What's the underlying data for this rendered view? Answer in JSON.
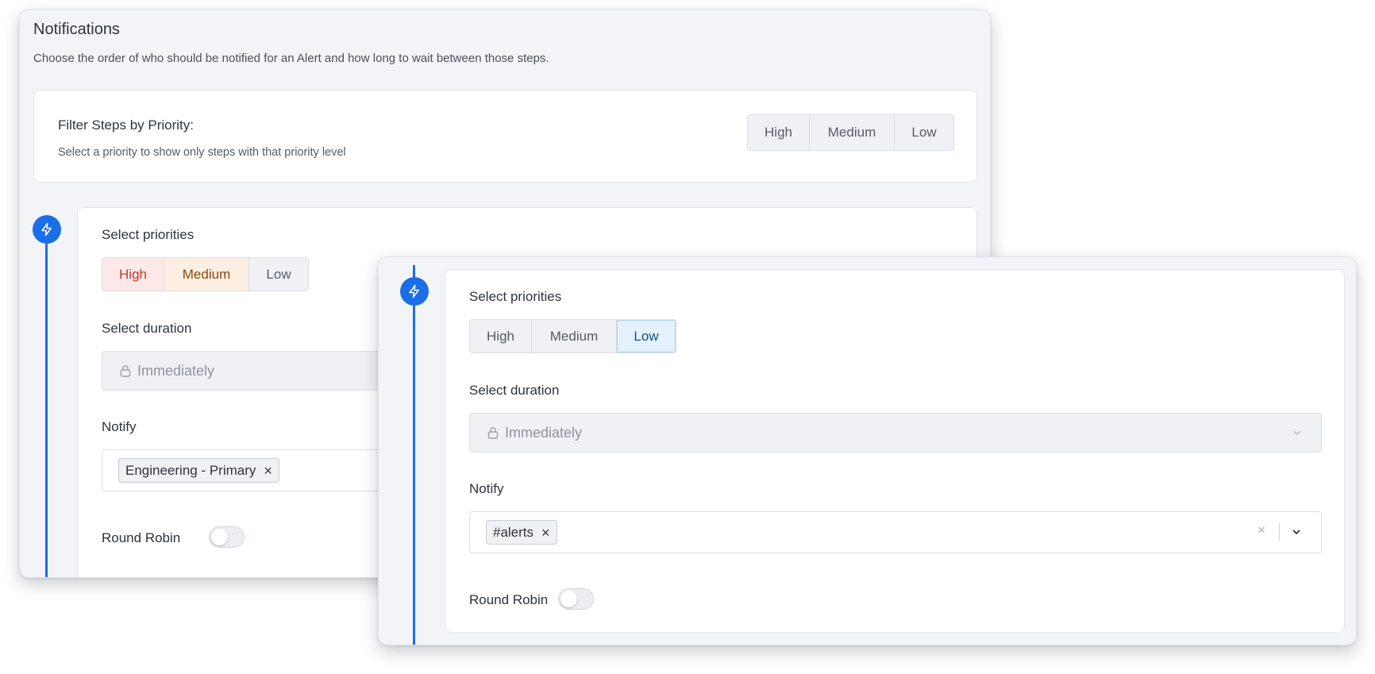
{
  "back_panel": {
    "title": "Notifications",
    "subtitle": "Choose the order of who should be notified for an Alert and how long to wait between those steps.",
    "filter": {
      "title": "Filter Steps by Priority:",
      "description": "Select a priority to show only steps with that priority level",
      "options": [
        "High",
        "Medium",
        "Low"
      ]
    },
    "step": {
      "icon": "lightning-bolt-icon",
      "priorities_label": "Select priorities",
      "priorities": [
        "High",
        "Medium",
        "Low"
      ],
      "selected_priorities": [
        "High",
        "Medium"
      ],
      "duration_label": "Select duration",
      "duration_value": "Immediately",
      "notify_label": "Notify",
      "notify_chips": [
        "Engineering - Primary"
      ],
      "round_robin_label": "Round Robin",
      "round_robin_on": false
    }
  },
  "front_panel": {
    "step": {
      "icon": "lightning-bolt-icon",
      "priorities_label": "Select priorities",
      "priorities": [
        "High",
        "Medium",
        "Low"
      ],
      "selected_priorities": [
        "Low"
      ],
      "duration_label": "Select duration",
      "duration_value": "Immediately",
      "notify_label": "Notify",
      "notify_chips": [
        "#alerts"
      ],
      "round_robin_label": "Round Robin",
      "round_robin_on": false
    }
  },
  "colors": {
    "accent": "#1b6ee8",
    "high_selected_bg": "#fde8e8",
    "medium_selected_bg": "#fdeee2",
    "low_selected_bg": "#e2f1fc"
  }
}
